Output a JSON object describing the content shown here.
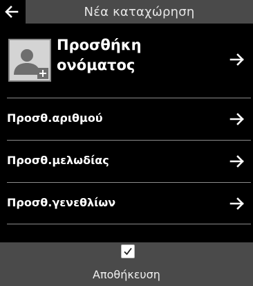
{
  "header": {
    "title": "Νέα καταχώρηση",
    "back_icon": "arrow-left-icon"
  },
  "name_entry": {
    "label_line1": "Προσθήκη",
    "label_line2": "ονόματος",
    "avatar_icon": "contact-add-icon",
    "arrow_icon": "arrow-right-icon"
  },
  "items": [
    {
      "label": "Προσθ.αριθμού",
      "arrow_icon": "arrow-right-icon"
    },
    {
      "label": "Προσθ.μελωδίας",
      "arrow_icon": "arrow-right-icon"
    },
    {
      "label": "Προσθ.γενεθλίων",
      "arrow_icon": "arrow-right-icon"
    }
  ],
  "footer": {
    "save_label": "Αποθήκευση",
    "check_icon": "checkmark-icon"
  },
  "colors": {
    "background": "#000000",
    "bar": "#4a4a4a",
    "separator": "#8c8c8c",
    "text": "#ffffff"
  }
}
